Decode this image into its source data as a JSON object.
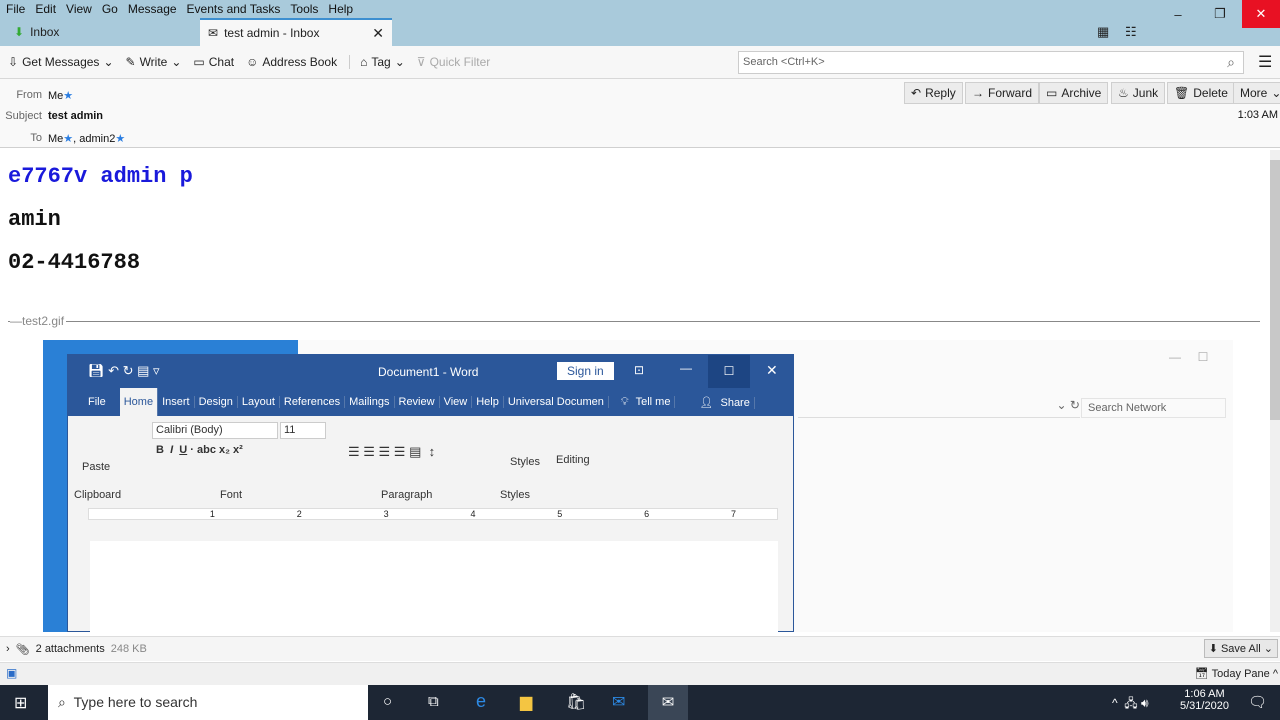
{
  "menu": [
    "File",
    "Edit",
    "View",
    "Go",
    "Message",
    "Events and Tasks",
    "Tools",
    "Help"
  ],
  "tabs": [
    {
      "label": "Inbox"
    },
    {
      "label": "test admin - Inbox"
    }
  ],
  "toolbar": {
    "get_messages": "Get Messages",
    "write": "Write",
    "chat": "Chat",
    "address_book": "Address Book",
    "tag": "Tag",
    "quick_filter": "Quick Filter",
    "search_placeholder": "Search <Ctrl+K>"
  },
  "header": {
    "from_label": "From",
    "from": "Me",
    "subject_label": "Subject",
    "subject": "test admin",
    "to_label": "To",
    "to_1": "Me",
    "to_2": ", admin2",
    "time": "1:03 AM"
  },
  "actions": [
    "Reply",
    "Forward",
    "Archive",
    "Junk",
    "Delete",
    "More"
  ],
  "body": {
    "line1": "e7767v  admin p",
    "line2": "amin",
    "line3": "02-4416788",
    "attachment_name": "test2.gif"
  },
  "word": {
    "title": "Document1  -  Word",
    "sign_in": "Sign in",
    "tabs": [
      "File",
      "Home",
      "Insert",
      "Design",
      "Layout",
      "References",
      "Mailings",
      "Review",
      "View",
      "Help",
      "Universal Documen"
    ],
    "tell_me": "Tell me",
    "share": "Share",
    "font": "Calibri (Body)",
    "size": "11",
    "paste": "Paste",
    "styles": "Styles",
    "editing": "Editing",
    "groups": [
      "Clipboard",
      "Font",
      "Paragraph",
      "Styles"
    ],
    "ruler": [
      "1",
      "2",
      "3",
      "4",
      "5",
      "6",
      "7"
    ]
  },
  "explorer": {
    "search": "Search Network"
  },
  "attachments": {
    "count": "2 attachments",
    "size": "248 KB",
    "save_all": "Save All"
  },
  "status": {
    "today_pane": "Today Pane"
  },
  "taskbar": {
    "search": "Type here to search",
    "time": "1:06 AM",
    "date": "5/31/2020"
  },
  "colors": {
    "accent": "#2b579a",
    "titlebar": "#a9cadb",
    "link": "#1a1adb"
  }
}
